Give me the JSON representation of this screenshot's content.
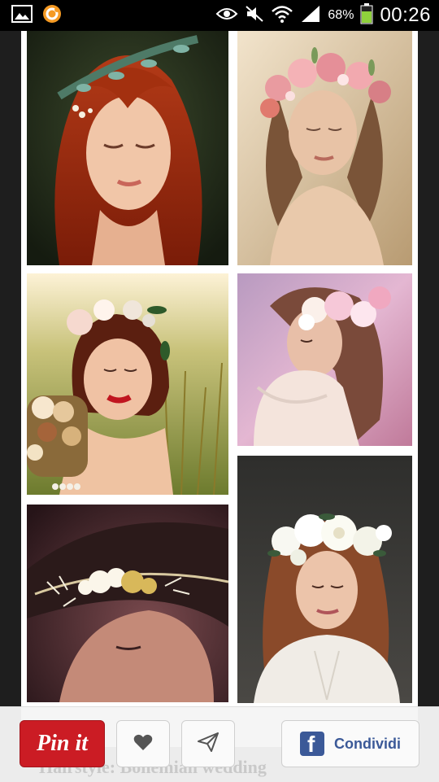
{
  "status_bar": {
    "battery": "68%",
    "time": "00:26",
    "icons": [
      "gallery-icon",
      "ubuntu-app-icon",
      "eye-icon",
      "mute-icon",
      "wifi-icon",
      "signal-icon",
      "battery-icon"
    ]
  },
  "pins": [
    {
      "name": "Red-haired woman with leafy branch crown"
    },
    {
      "name": "Woman with pink rose flower crown"
    },
    {
      "name": "Woman with flower crown holding bouquet"
    },
    {
      "name": "Woman in white dress with white roses"
    },
    {
      "name": "Woman with white floral vine headband"
    },
    {
      "name": "Woman with white rose flower crown"
    }
  ],
  "actions": {
    "pin_label": "Pin it",
    "share_label": "Condividi",
    "footer_caption": "Hairstyle: Bohemian wedding"
  },
  "colors": {
    "pinit_red": "#cb1c24",
    "facebook_blue": "#3b5998"
  }
}
